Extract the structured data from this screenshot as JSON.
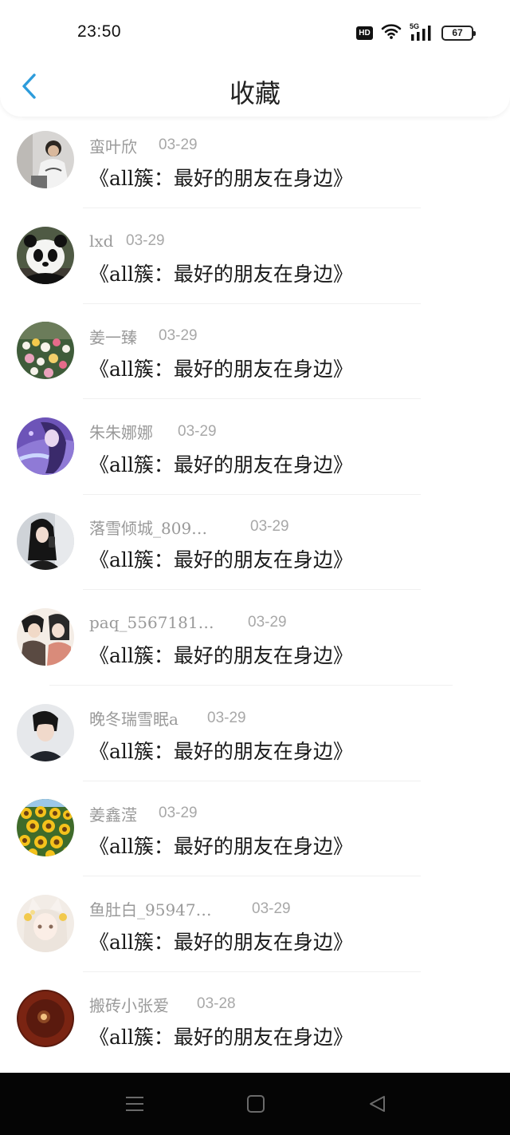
{
  "status_bar": {
    "time": "23:50",
    "hd_label": "HD",
    "network_label": "5G",
    "battery_level": "67"
  },
  "header": {
    "title": "收藏",
    "back_icon": "chevron-left-icon",
    "accent_color": "#2d9cdb"
  },
  "favorites": [
    {
      "username": "蛮叶欣",
      "date": "03-29",
      "title": "《all簇：最好的朋友在身边》",
      "avatar": "person-photo-avatar"
    },
    {
      "username": "lxd",
      "date": "03-29",
      "title": "《all簇：最好的朋友在身边》",
      "avatar": "panda-avatar"
    },
    {
      "username": "姜一臻",
      "date": "03-29",
      "title": "《all簇：最好的朋友在身边》",
      "avatar": "flowers-avatar"
    },
    {
      "username": "朱朱娜娜",
      "date": "03-29",
      "title": "《all簇：最好的朋友在身边》",
      "avatar": "anime-girl-avatar"
    },
    {
      "username": "落雪倾城_809…",
      "date": "03-29",
      "title": "《all簇：最好的朋友在身边》",
      "avatar": "girl-photo-avatar"
    },
    {
      "username": "paq_5567181…",
      "date": "03-29",
      "title": "《all簇：最好的朋友在身边》",
      "avatar": "comic-couple-avatar"
    },
    {
      "username": "晚冬瑞雪眠a",
      "date": "03-29",
      "title": "《all簇：最好的朋友在身边》",
      "avatar": "boy-photo-avatar"
    },
    {
      "username": "姜鑫滢",
      "date": "03-29",
      "title": "《all簇：最好的朋友在身边》",
      "avatar": "sunflowers-avatar"
    },
    {
      "username": "鱼肚白_95947…",
      "date": "03-29",
      "title": "《all簇：最好的朋友在身边》",
      "avatar": "cat-girl-avatar"
    },
    {
      "username": "搬砖小张爱",
      "date": "03-28",
      "title": "《all簇：最好的朋友在身边》",
      "avatar": "moon-avatar"
    }
  ],
  "system_nav": {
    "menu_icon": "menu-icon",
    "home_icon": "home-square-icon",
    "back_icon": "back-triangle-icon"
  }
}
